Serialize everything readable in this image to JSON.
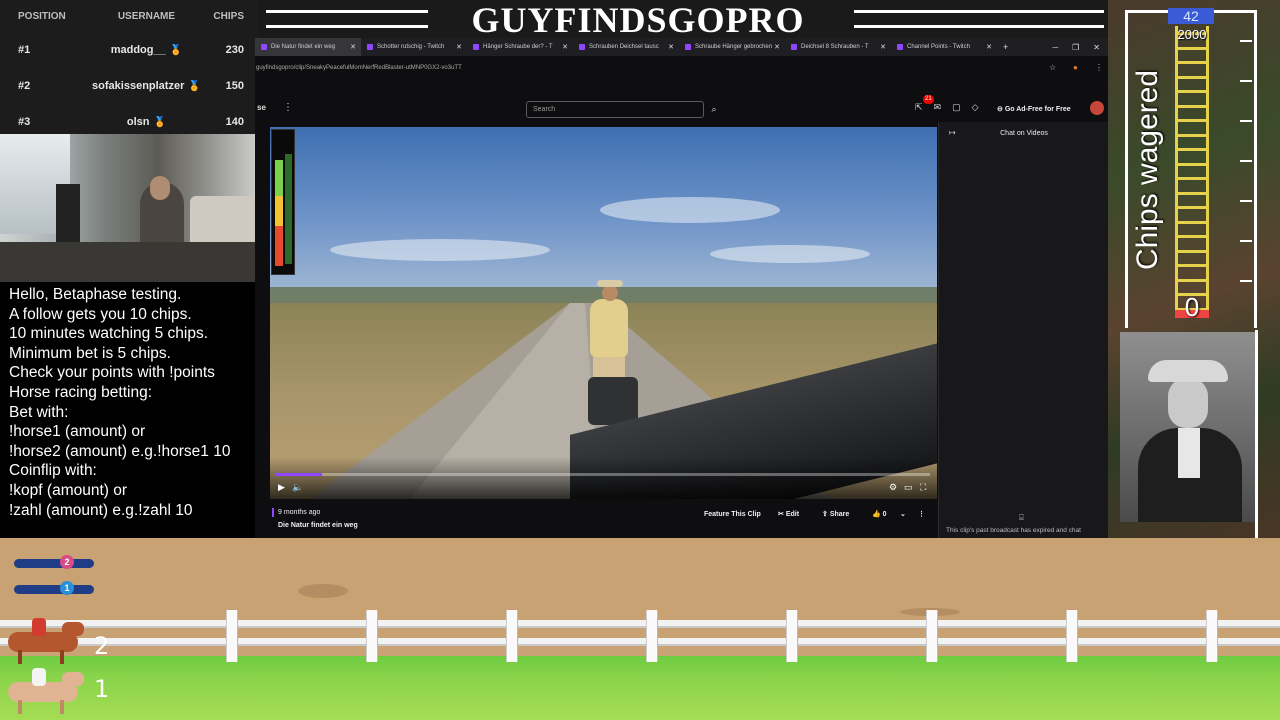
{
  "leaderboard": {
    "headers": {
      "position": "POSITION",
      "username": "USERNAME",
      "chips": "CHIPS"
    },
    "rows": [
      {
        "pos": "#1",
        "user": "maddog__",
        "chips": "230"
      },
      {
        "pos": "#2",
        "user": "sofakissenplatzer",
        "chips": "150"
      },
      {
        "pos": "#3",
        "user": "olsn",
        "chips": "140"
      }
    ]
  },
  "info_lines": [
    "Hello, Betaphase testing.",
    "A follow gets you 10 chips.",
    "10 minutes watching 5 chips.",
    "Minimum bet is 5 chips.",
    "Check your points with !points",
    "Horse racing betting:",
    "Bet with:",
    "!horse1 (amount) or",
    "!horse2 (amount) e.g.!horse1 10",
    "Coinflip with:",
    "!kopf (amount) or",
    "!zahl (amount) e.g.!zahl 10"
  ],
  "stream_title": "GUYFINDSGOPRO",
  "browser": {
    "tabs": [
      {
        "label": "Die Natur findet ein weg",
        "active": true
      },
      {
        "label": "Schotter rutschig - Twitch",
        "active": false
      },
      {
        "label": "Hänger Schraube der? - T",
        "active": false
      },
      {
        "label": "Schrauben Deichsel tausc",
        "active": false
      },
      {
        "label": "Schraube Hänger gebrochen",
        "active": false
      },
      {
        "label": "Deichsel 8 Schrauben - T",
        "active": false
      },
      {
        "label": "Channel Points - Twitch",
        "active": false
      }
    ],
    "url": "guyfindsgopro/clip/SneakyPeacefulMomNerfRedBlaster-utMNP0GX2-vo3uTT",
    "brand_fragment": "se",
    "search_placeholder": "Search",
    "notification_count": "21",
    "ad_free_label": "Go Ad-Free for Free",
    "clip": {
      "posted": "9 months ago",
      "title": "Die Natur findet ein weg",
      "progress": 0.07,
      "feature_label": "Feature This Clip",
      "edit_label": "Edit",
      "share_label": "Share",
      "likes": "0"
    },
    "chat": {
      "header": "Chat on Videos",
      "notice": "This clip's past broadcast has expired and chat"
    }
  },
  "wager": {
    "label": "Chips wagered",
    "current": "42",
    "max": "2000",
    "min": "0"
  },
  "race": {
    "dogs": [
      "2",
      "1"
    ],
    "horses": [
      "2",
      "1"
    ]
  },
  "colors": {
    "twitch_purple": "#9146ff",
    "ladder_yellow": "#e6d24a",
    "grass_green": "#8bd44b"
  }
}
